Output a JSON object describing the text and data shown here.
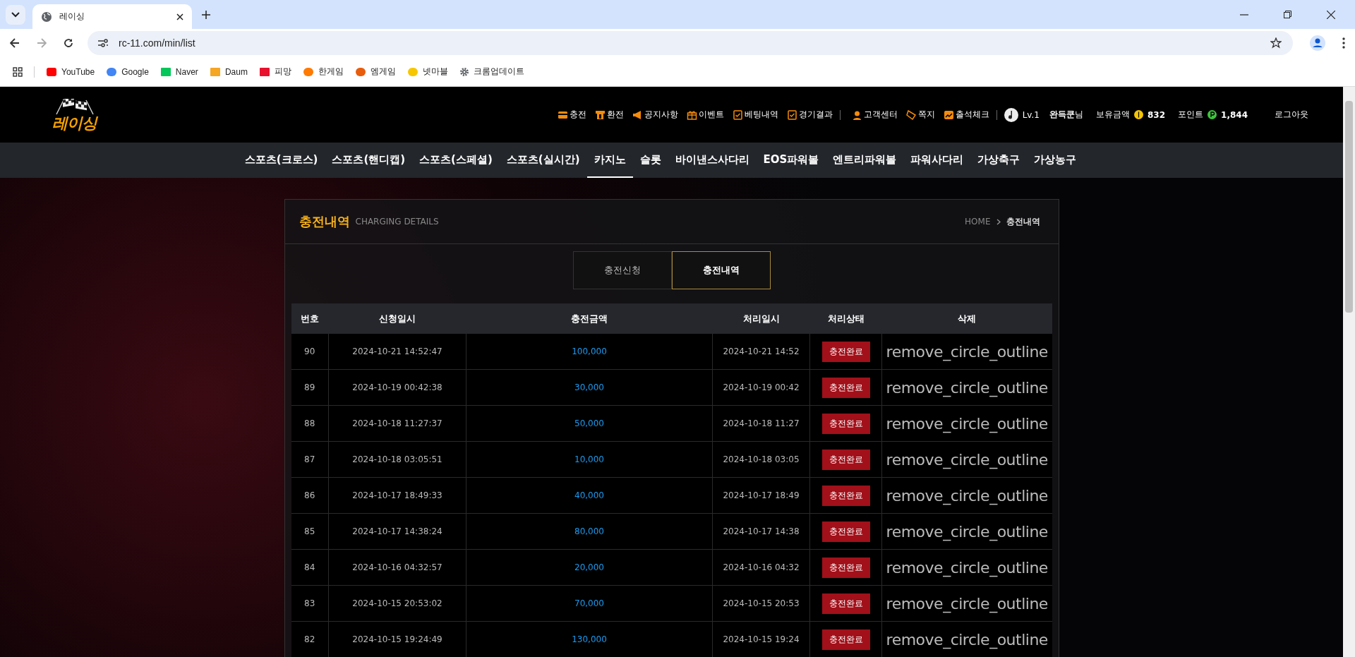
{
  "browser": {
    "tab_title": "레이싱",
    "url": "rc-11.com/min/list",
    "bookmarks": [
      {
        "label": "YouTube",
        "kind": "youtube"
      },
      {
        "label": "Google",
        "kind": "google"
      },
      {
        "label": "Naver",
        "kind": "naver"
      },
      {
        "label": "Daum",
        "kind": "daum"
      },
      {
        "label": "피망",
        "kind": "pmang"
      },
      {
        "label": "한게임",
        "kind": "hangame"
      },
      {
        "label": "엠게임",
        "kind": "mgame"
      },
      {
        "label": "넷마블",
        "kind": "netmarble"
      },
      {
        "label": "크롬업데이트",
        "kind": "gear"
      }
    ]
  },
  "site": {
    "logo": "레이싱",
    "top_links": [
      {
        "label": "충전",
        "kind": "card"
      },
      {
        "label": "환전",
        "kind": "atm"
      },
      {
        "label": "공지사항",
        "kind": "megaphone"
      },
      {
        "label": "이벤트",
        "kind": "gift"
      },
      {
        "label": "베팅내역",
        "kind": "check"
      },
      {
        "label": "경기결과",
        "kind": "check"
      },
      {
        "label": "고객센터",
        "kind": "agent"
      },
      {
        "label": "쪽지",
        "kind": "note"
      },
      {
        "label": "출석체크",
        "kind": "chart"
      }
    ],
    "user": {
      "level": "Lv.1",
      "name": "완득쿤",
      "suffix": "님",
      "balance_label": "보유금액",
      "balance": "832",
      "points_label": "포인트",
      "points": "1,844",
      "logout": "로그아웃"
    },
    "nav": [
      {
        "label": "스포츠(크로스)",
        "selected": false
      },
      {
        "label": "스포츠(핸디캡)",
        "selected": false
      },
      {
        "label": "스포츠(스페셜)",
        "selected": false
      },
      {
        "label": "스포츠(실시간)",
        "selected": false
      },
      {
        "label": "카지노",
        "selected": true
      },
      {
        "label": "슬롯",
        "selected": false
      },
      {
        "label": "바이낸스사다리",
        "selected": false
      },
      {
        "label": "EOS파워볼",
        "selected": false
      },
      {
        "label": "엔트리파워볼",
        "selected": false
      },
      {
        "label": "파워사다리",
        "selected": false
      },
      {
        "label": "가상축구",
        "selected": false
      },
      {
        "label": "가상농구",
        "selected": false
      }
    ]
  },
  "panel": {
    "title": "충전내역",
    "subtitle": "CHARGING DETAILS",
    "breadcrumb": [
      "HOME",
      "충전내역"
    ],
    "tabs": [
      {
        "label": "충전신청",
        "selected": false
      },
      {
        "label": "충전내역",
        "selected": true
      }
    ],
    "table": {
      "columns": [
        "번호",
        "신청일시",
        "충전금액",
        "처리일시",
        "처리상태",
        "삭제"
      ],
      "rows": [
        {
          "no": "90",
          "requested": "2024-10-21 14:52:47",
          "amount": "100,000",
          "processed": "2024-10-21 14:52",
          "status": "충전완료",
          "delete": "remove_circle_outline"
        },
        {
          "no": "89",
          "requested": "2024-10-19 00:42:38",
          "amount": "30,000",
          "processed": "2024-10-19 00:42",
          "status": "충전완료",
          "delete": "remove_circle_outline"
        },
        {
          "no": "88",
          "requested": "2024-10-18 11:27:37",
          "amount": "50,000",
          "processed": "2024-10-18 11:27",
          "status": "충전완료",
          "delete": "remove_circle_outline"
        },
        {
          "no": "87",
          "requested": "2024-10-18 03:05:51",
          "amount": "10,000",
          "processed": "2024-10-18 03:05",
          "status": "충전완료",
          "delete": "remove_circle_outline"
        },
        {
          "no": "86",
          "requested": "2024-10-17 18:49:33",
          "amount": "40,000",
          "processed": "2024-10-17 18:49",
          "status": "충전완료",
          "delete": "remove_circle_outline"
        },
        {
          "no": "85",
          "requested": "2024-10-17 14:38:24",
          "amount": "80,000",
          "processed": "2024-10-17 14:38",
          "status": "충전완료",
          "delete": "remove_circle_outline"
        },
        {
          "no": "84",
          "requested": "2024-10-16 04:32:57",
          "amount": "20,000",
          "processed": "2024-10-16 04:32",
          "status": "충전완료",
          "delete": "remove_circle_outline"
        },
        {
          "no": "83",
          "requested": "2024-10-15 20:53:02",
          "amount": "70,000",
          "processed": "2024-10-15 20:53",
          "status": "충전완료",
          "delete": "remove_circle_outline"
        },
        {
          "no": "82",
          "requested": "2024-10-15 19:24:49",
          "amount": "130,000",
          "processed": "2024-10-15 19:24",
          "status": "충전완료",
          "delete": "remove_circle_outline"
        }
      ]
    }
  }
}
